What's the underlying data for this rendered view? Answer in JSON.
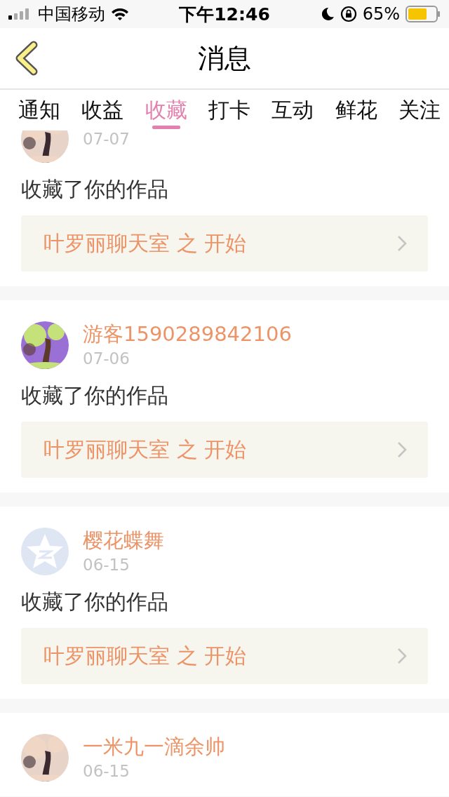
{
  "status_bar": {
    "carrier": "中国移动",
    "time": "下午12:46",
    "battery": "65%"
  },
  "nav": {
    "title": "消息"
  },
  "tabs": [
    {
      "label": "通知",
      "selected": false
    },
    {
      "label": "收益",
      "selected": false
    },
    {
      "label": "收藏",
      "selected": true
    },
    {
      "label": "打卡",
      "selected": false
    },
    {
      "label": "互动",
      "selected": false
    },
    {
      "label": "鲜花",
      "selected": false
    },
    {
      "label": "关注",
      "selected": false
    }
  ],
  "messages": [
    {
      "date": "07-07",
      "action": "收藏了你的作品",
      "work": "叶罗丽聊天室 之 开始"
    },
    {
      "name": "游客1590289842106",
      "date": "07-06",
      "action": "收藏了你的作品",
      "work": "叶罗丽聊天室 之 开始"
    },
    {
      "avatar": {
        "kind": "default"
      },
      "name": "樱花蝶舞",
      "date": "06-15",
      "action": "收藏了你的作品",
      "work": "叶罗丽聊天室 之 开始"
    },
    {
      "name": "一米九一滴余帅",
      "date": "06-15"
    }
  ]
}
